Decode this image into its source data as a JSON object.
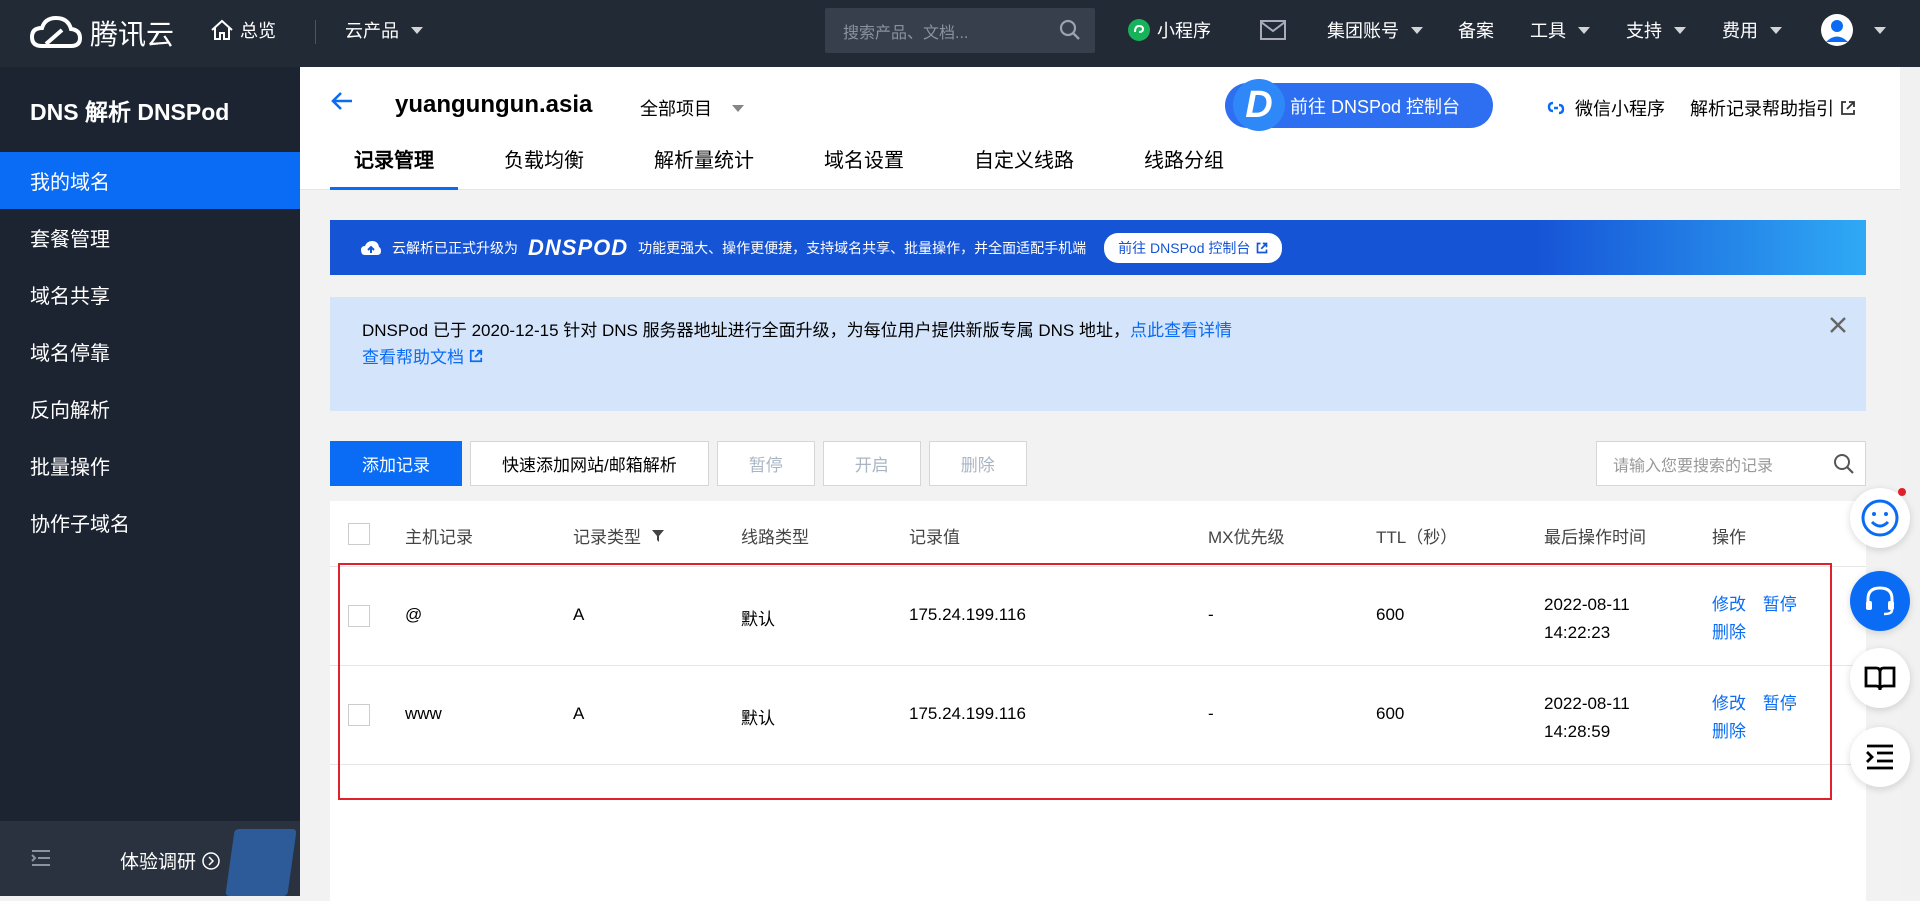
{
  "topbar": {
    "brand": "腾讯云",
    "overview": "总览",
    "products": "云产品",
    "search_placeholder": "搜索产品、文档...",
    "miniprogram": "小程序",
    "group_account": "集团账号",
    "beian": "备案",
    "tools": "工具",
    "support": "支持",
    "fees": "费用"
  },
  "sidebar": {
    "title": "DNS 解析 DNSPod",
    "items": [
      {
        "label": "我的域名"
      },
      {
        "label": "套餐管理"
      },
      {
        "label": "域名共享"
      },
      {
        "label": "域名停靠"
      },
      {
        "label": "反向解析"
      },
      {
        "label": "批量操作"
      },
      {
        "label": "协作子域名"
      }
    ],
    "footer_label": "体验调研"
  },
  "header": {
    "domain": "yuangungun.asia",
    "project": "全部项目",
    "dnspod_button": "前往 DNSPod 控制台",
    "dnspod_logo": "D",
    "wechat": "微信小程序",
    "help_guide": "解析记录帮助指引",
    "tabs": [
      {
        "label": "记录管理"
      },
      {
        "label": "负载均衡"
      },
      {
        "label": "解析量统计"
      },
      {
        "label": "域名设置"
      },
      {
        "label": "自定义线路"
      },
      {
        "label": "线路分组"
      }
    ]
  },
  "banner": {
    "text1": "云解析已正式升级为",
    "brand": "DNSPOD",
    "text2": "功能更强大、操作更便捷，支持域名共享、批量操作，并全面适配手机端",
    "button": "前往 DNSPod 控制台"
  },
  "notice": {
    "line1": "DNSPod 已于 2020-12-15 针对 DNS 服务器地址进行全面升级，为每位用户提供新版专属 DNS 地址，",
    "link1": "点此查看详情",
    "link2": "查看帮助文档"
  },
  "actions": {
    "add": "添加记录",
    "quick_add": "快速添加网站/邮箱解析",
    "pause": "暂停",
    "enable": "开启",
    "delete": "删除",
    "search_placeholder": "请输入您要搜索的记录"
  },
  "table": {
    "columns": [
      "主机记录",
      "记录类型",
      "线路类型",
      "记录值",
      "MX优先级",
      "TTL（秒）",
      "最后操作时间",
      "操作"
    ],
    "rows": [
      {
        "host": "@",
        "type": "A",
        "line": "默认",
        "value": "175.24.199.116",
        "mx": "-",
        "ttl": "600",
        "date": "2022-08-11",
        "time": "14:22:23",
        "op_edit": "修改",
        "op_pause": "暂停",
        "op_delete": "删除"
      },
      {
        "host": "www",
        "type": "A",
        "line": "默认",
        "value": "175.24.199.116",
        "mx": "-",
        "ttl": "600",
        "date": "2022-08-11",
        "time": "14:28:59",
        "op_edit": "修改",
        "op_pause": "暂停",
        "op_delete": "删除"
      }
    ]
  },
  "colors": {
    "primary": "#0a6cf5",
    "topbar": "#222a35",
    "sidebar": "#1c2431",
    "highlight": "#e0202a"
  }
}
